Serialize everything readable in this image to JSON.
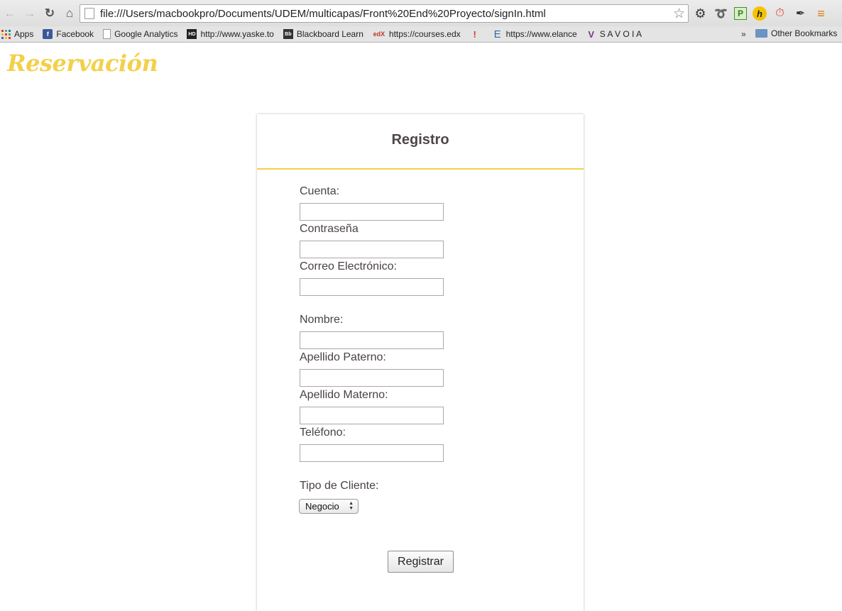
{
  "browser": {
    "url": "file:///Users/macbookpro/Documents/UDEM/multicapas/Front%20End%20Proyecto/signIn.html",
    "nav": {
      "back_icon": "back-arrow-icon",
      "forward_icon": "forward-arrow-icon",
      "reload_icon": "reload-icon",
      "home_icon": "home-icon"
    },
    "bookmarks": {
      "apps": "Apps",
      "facebook": "Facebook",
      "google_analytics": "Google Analytics",
      "yaske": "http://www.yaske.to",
      "blackboard": "Blackboard Learn",
      "edx": "https://courses.edx",
      "elance": "https://www.elance",
      "savoia": "S A V O I A",
      "overflow": "»",
      "other": "Other Bookmarks"
    }
  },
  "page": {
    "brand": "Reservación",
    "form": {
      "title": "Registro",
      "labels": {
        "cuenta": "Cuenta:",
        "contrasena": "Contraseña",
        "correo": "Correo Electrónico:",
        "nombre": "Nombre:",
        "apellido_paterno": "Apellido Paterno:",
        "apellido_materno": "Apellido Materno:",
        "telefono": "Teléfono:",
        "tipo_cliente": "Tipo de Cliente:"
      },
      "values": {
        "cuenta": "",
        "contrasena": "",
        "correo": "",
        "nombre": "",
        "apellido_paterno": "",
        "apellido_materno": "",
        "telefono": ""
      },
      "tipo_cliente_selected": "Negocio",
      "submit_label": "Registrar"
    }
  },
  "colors": {
    "accent": "#f2d04a",
    "title": "#4e4646",
    "label": "#4a4242"
  }
}
